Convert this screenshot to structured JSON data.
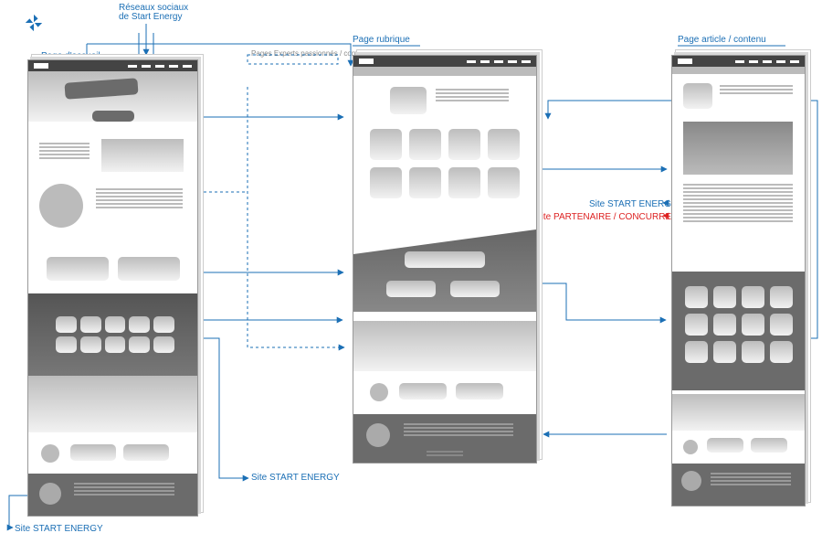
{
  "diagram": {
    "title_homepage": "Page d'accueil",
    "title_rubrique": "Page rubrique",
    "title_article": "Page article / contenu",
    "social_label": "Réseaux sociaux\nde Start Energy",
    "experts_label": "Pages Experts passionnés / contact",
    "link_site_energy": "Site START ENERGY",
    "link_site_energy_2": "Site START ENERGY",
    "link_site_energy_3": "Site START ENERGY",
    "link_partner": "Site PARTENAIRE / CONCURRENT"
  }
}
